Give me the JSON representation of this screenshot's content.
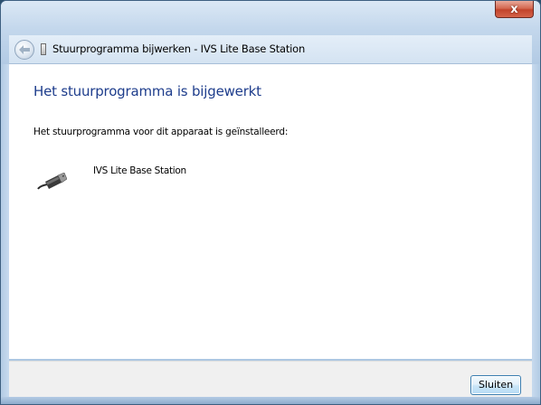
{
  "window": {
    "title": "Stuurprogramma bijwerken - IVS Lite Base Station",
    "close_glyph": "x"
  },
  "content": {
    "heading": "Het stuurprogramma is bijgewerkt",
    "message": "Het stuurprogramma voor dit apparaat is geïnstalleerd:",
    "device_name": "IVS Lite Base Station",
    "device_icon": "usb-plug-icon"
  },
  "footer": {
    "close_label": "Sluiten"
  },
  "colors": {
    "heading": "#1e3d8c",
    "close_button": "#c2442c"
  }
}
